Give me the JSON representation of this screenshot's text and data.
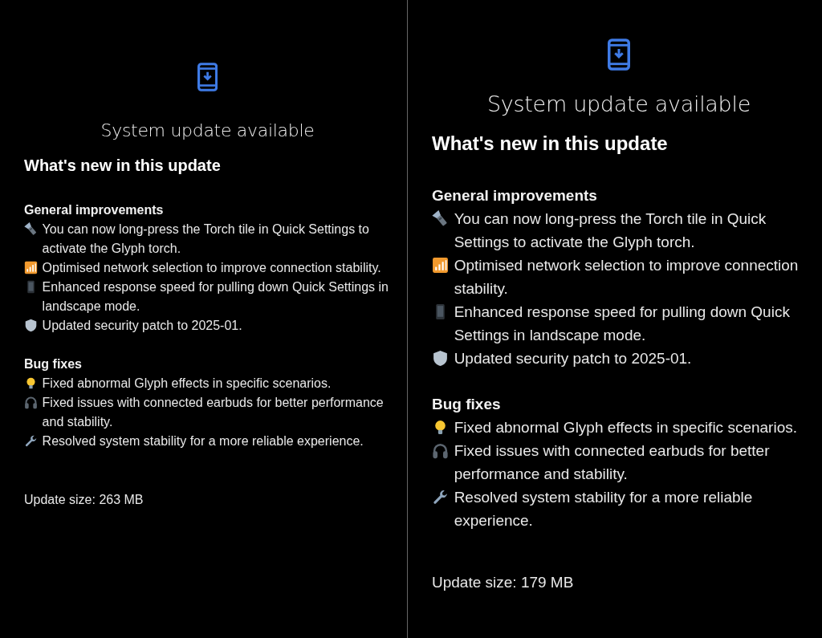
{
  "panels": [
    {
      "title": "System update available",
      "heading": "What's new in this update",
      "sections": [
        {
          "title": "General improvements",
          "items": [
            {
              "kind": "torch",
              "text": "You can now long-press the Torch tile in Quick Settings to activate the Glyph torch."
            },
            {
              "kind": "signal",
              "text": "Optimised network selection to improve connection stability."
            },
            {
              "kind": "phone",
              "text": "Enhanced response speed for pulling down Quick Settings in landscape mode."
            },
            {
              "kind": "shield",
              "text": "Updated security patch to 2025-01."
            }
          ]
        },
        {
          "title": "Bug fixes",
          "items": [
            {
              "kind": "bulb",
              "text": "Fixed abnormal Glyph effects in specific scenarios."
            },
            {
              "kind": "headphones",
              "text": "Fixed issues with connected earbuds for better performance and stability."
            },
            {
              "kind": "wrench",
              "text": "Resolved system stability for a more reliable experience."
            }
          ]
        }
      ],
      "update_size": "Update size: 263 MB"
    },
    {
      "title": "System update available",
      "heading": "What's new in this update",
      "sections": [
        {
          "title": "General improvements",
          "items": [
            {
              "kind": "torch",
              "text": "You can now long-press the Torch tile in Quick Settings to activate the Glyph torch."
            },
            {
              "kind": "signal",
              "text": "Optimised network selection to improve connection stability."
            },
            {
              "kind": "phone",
              "text": "Enhanced response speed for pulling down Quick Settings in landscape mode."
            },
            {
              "kind": "shield",
              "text": "Updated security patch to 2025-01."
            }
          ]
        },
        {
          "title": "Bug fixes",
          "items": [
            {
              "kind": "bulb",
              "text": "Fixed abnormal Glyph effects in specific scenarios."
            },
            {
              "kind": "headphones",
              "text": "Fixed issues with connected earbuds for better performance and stability."
            },
            {
              "kind": "wrench",
              "text": "Resolved system stability for a more reliable experience."
            }
          ]
        }
      ],
      "update_size": "Update size: 179 MB"
    }
  ]
}
